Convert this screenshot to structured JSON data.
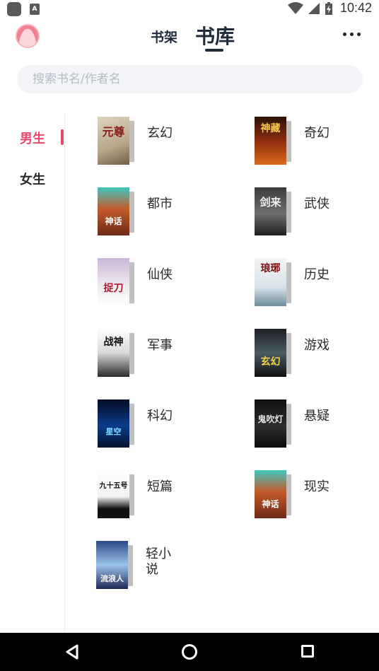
{
  "status_bar": {
    "time": "10:42",
    "icons": [
      "app-icon",
      "translate-app-icon",
      "wifi-icon",
      "signal-icon",
      "battery-charging-icon"
    ]
  },
  "header": {
    "tabs": [
      {
        "label": "书架",
        "active": false
      },
      {
        "label": "书库",
        "active": true
      }
    ],
    "more_icon": "more-horizontal-icon"
  },
  "search": {
    "placeholder": "搜索书名/作者名"
  },
  "side_nav": {
    "items": [
      {
        "label": "男生",
        "active": true
      },
      {
        "label": "女生",
        "active": false
      }
    ],
    "accent_color": "#e5486a"
  },
  "categories": [
    {
      "label": "玄幻",
      "cover_text": "元尊"
    },
    {
      "label": "奇幻",
      "cover_text": "神藏"
    },
    {
      "label": "都市",
      "cover_text": "神话"
    },
    {
      "label": "武侠",
      "cover_text": "剑来"
    },
    {
      "label": "仙侠",
      "cover_text": "捉刀"
    },
    {
      "label": "历史",
      "cover_text": "琅琊"
    },
    {
      "label": "军事",
      "cover_text": "战神"
    },
    {
      "label": "游戏",
      "cover_text": "玄幻"
    },
    {
      "label": "科幻",
      "cover_text": "星空"
    },
    {
      "label": "悬疑",
      "cover_text": "鬼吹灯"
    },
    {
      "label": "短篇",
      "cover_text": "九十五号"
    },
    {
      "label": "现实",
      "cover_text": "神话"
    },
    {
      "label": "轻小说",
      "cover_text": "流浪人"
    }
  ],
  "nav_bar": {
    "icons": [
      "back-icon",
      "home-icon",
      "recents-icon"
    ]
  }
}
